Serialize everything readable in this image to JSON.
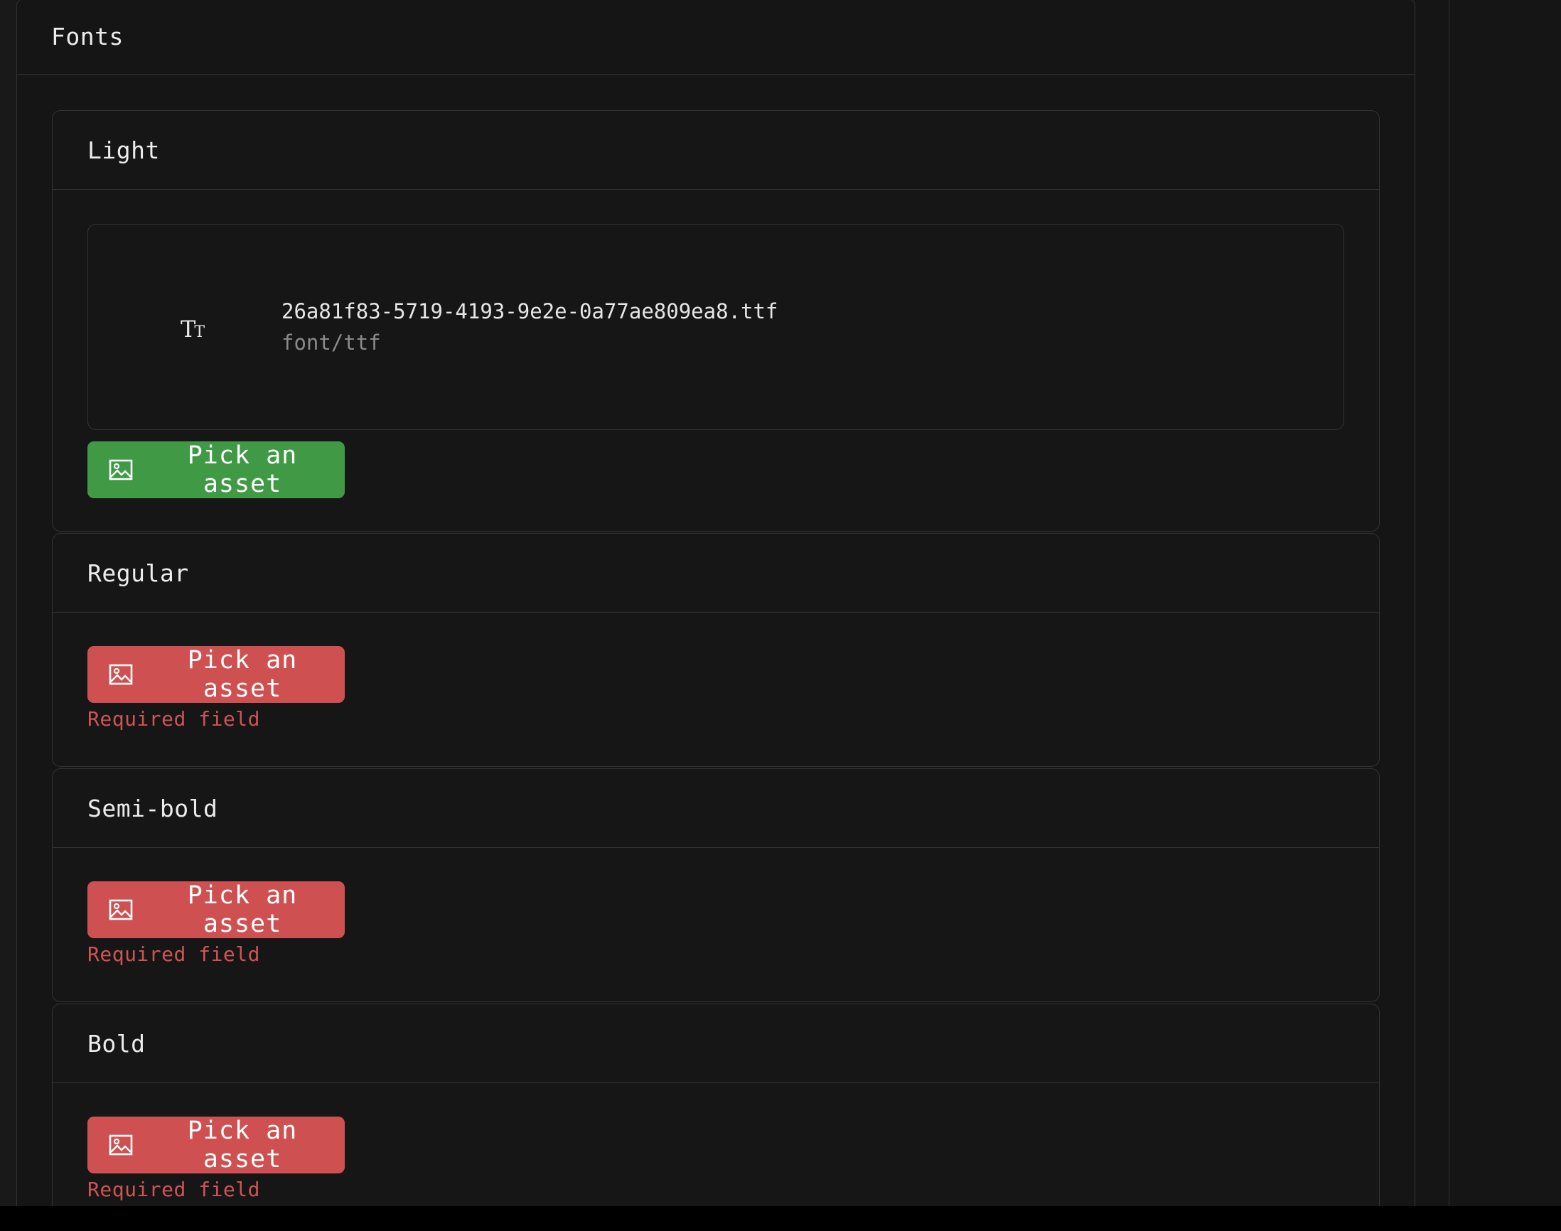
{
  "panel": {
    "title": "Fonts"
  },
  "cards": [
    {
      "title": "Light",
      "asset": {
        "filename": "26a81f83-5719-4193-9e2e-0a77ae809ea8.ttf",
        "mime": "font/ttf",
        "icon": "font-type-icon",
        "glyph_big": "T",
        "glyph_small": "T"
      },
      "button_label": "Pick an asset",
      "button_state": "ok"
    },
    {
      "title": "Regular",
      "button_label": "Pick an asset",
      "button_state": "error",
      "error": "Required field"
    },
    {
      "title": "Semi-bold",
      "button_label": "Pick an asset",
      "button_state": "error",
      "error": "Required field"
    },
    {
      "title": "Bold",
      "button_label": "Pick an asset",
      "button_state": "error",
      "error": "Required field"
    }
  ],
  "colors": {
    "background": "#151515",
    "border": "#333333",
    "success": "#3f9945",
    "danger": "#cf5050",
    "error_text": "#d05454"
  }
}
